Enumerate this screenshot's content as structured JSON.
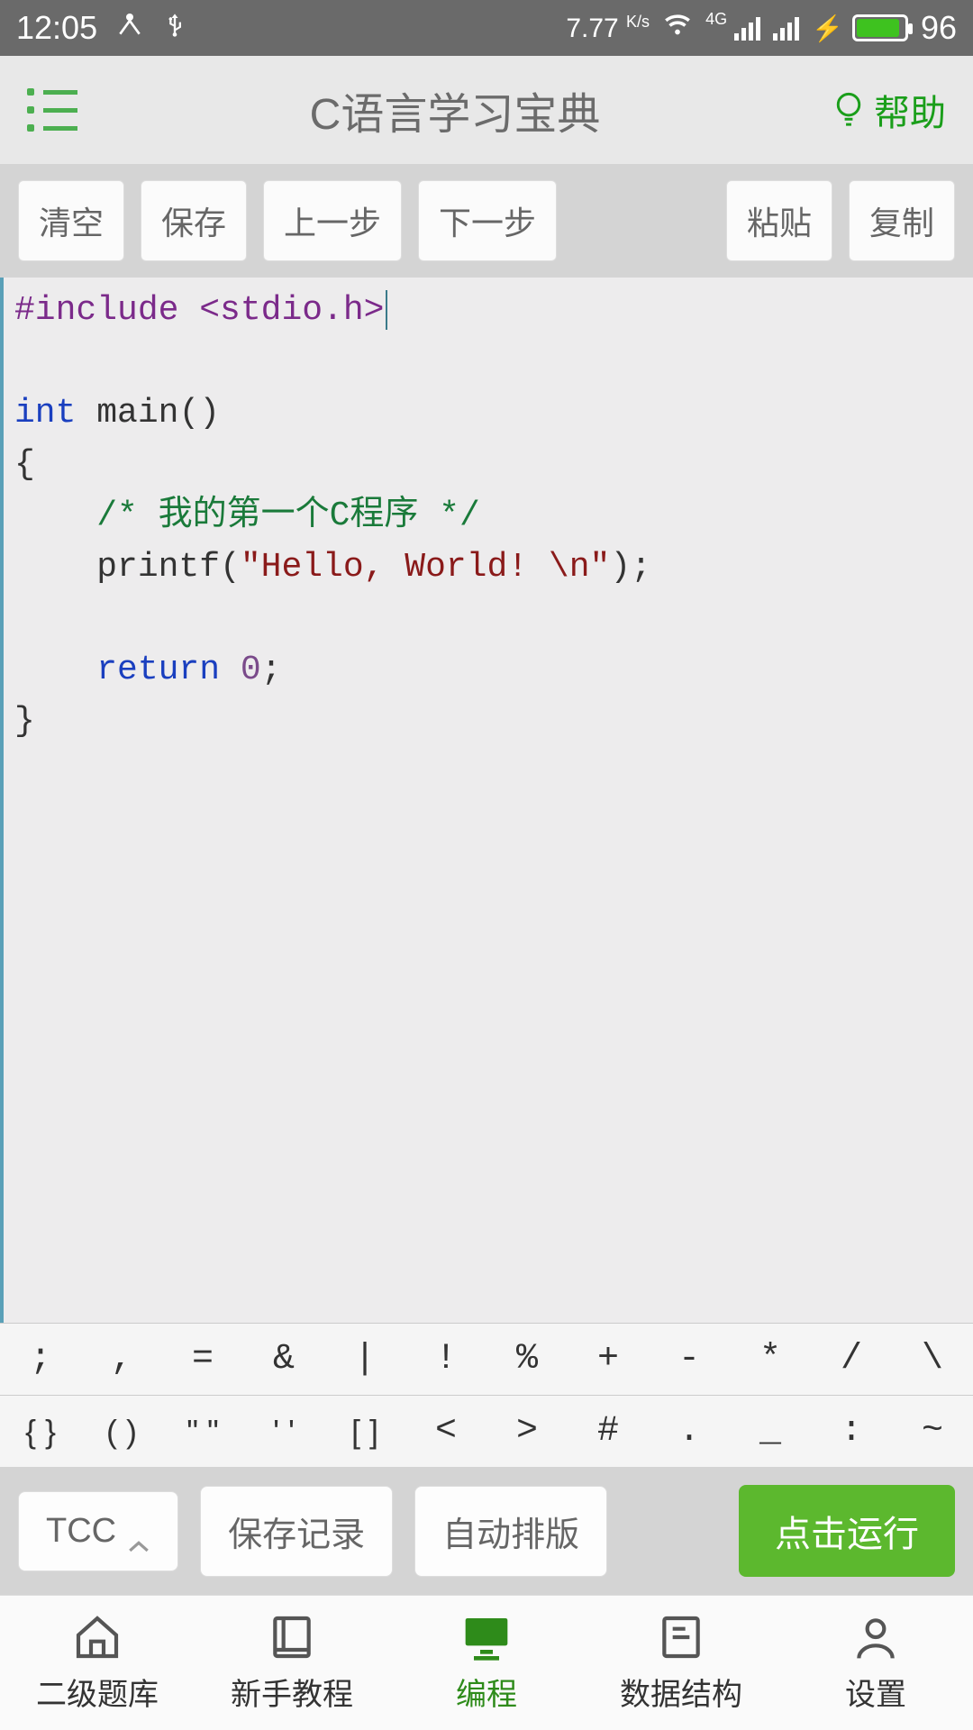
{
  "status": {
    "time": "12:05",
    "speed": "7.77",
    "speed_unit": "K/s",
    "net_gen": "4G",
    "battery": "96"
  },
  "header": {
    "title": "C语言学习宝典",
    "help": "帮助"
  },
  "toolbar": {
    "clear": "清空",
    "save": "保存",
    "undo": "上一步",
    "redo": "下一步",
    "paste": "粘贴",
    "copy": "复制"
  },
  "code": {
    "line1_pre": "#include <stdio.h>",
    "line3_kw": "int",
    "line3_rest": " main()",
    "line4": "{",
    "line5_indent": "    ",
    "line5_com": "/* 我的第一个C程序 */",
    "line6_indent": "    printf(",
    "line6_str": "\"Hello, World! \\n\"",
    "line6_end": ");",
    "line8_indent": "    ",
    "line8_kw": "return",
    "line8_sp": " ",
    "line8_num": "0",
    "line8_end": ";",
    "line9": "}"
  },
  "symbols_row1": [
    ";",
    ",",
    "=",
    "&",
    "|",
    "!",
    "%",
    "+",
    "-",
    "*",
    "/",
    "\\"
  ],
  "symbols_row2": [
    "{ }",
    "( )",
    "\" \"",
    "' '",
    "[ ]",
    "<",
    ">",
    "#",
    ".",
    "_",
    ":",
    "~"
  ],
  "compiler": {
    "tcc": "TCC",
    "save_history": "保存记录",
    "format": "自动排版",
    "run": "点击运行"
  },
  "nav": {
    "exam": "二级题库",
    "tutorial": "新手教程",
    "code": "编程",
    "ds": "数据结构",
    "settings": "设置"
  }
}
